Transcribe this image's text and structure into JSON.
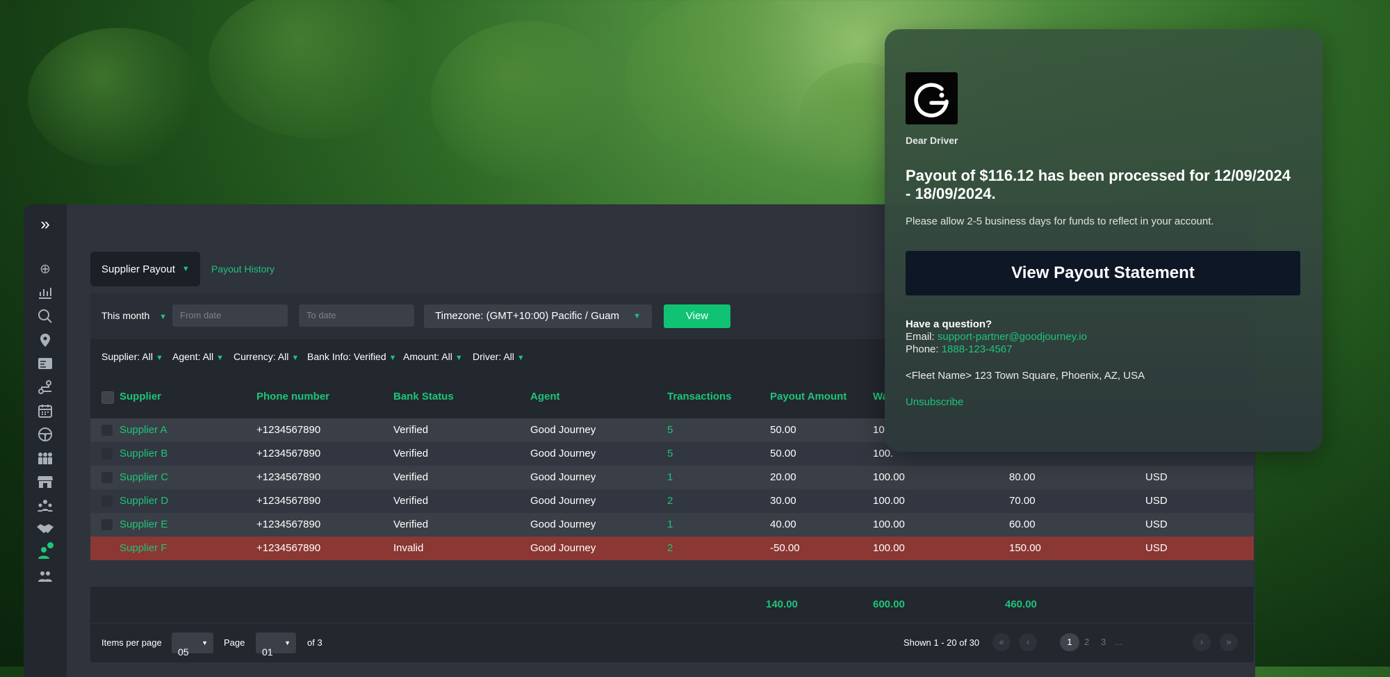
{
  "tabs": {
    "active": "Supplier Payout",
    "secondary": "Payout History"
  },
  "filters": {
    "period": "This month",
    "from_placeholder": "From date",
    "to_placeholder": "To date",
    "timezone": "Timezone: (GMT+10:00) Pacific / Guam",
    "view_label": "View"
  },
  "chips": [
    "Supplier: All",
    "Agent: All",
    "Currency: All",
    "Bank Info: Verified",
    "Amount: All",
    "Driver: All"
  ],
  "table": {
    "headers": [
      "Supplier",
      "Phone number",
      "Bank Status",
      "Agent",
      "Transactions",
      "Payout Amount",
      "Wa"
    ],
    "rows": [
      [
        "Supplier A",
        "+1234567890",
        "Verified",
        "Good Journey",
        "5",
        "50.00",
        "10",
        "",
        ""
      ],
      [
        "Supplier B",
        "+1234567890",
        "Verified",
        "Good Journey",
        "5",
        "50.00",
        "100.",
        "",
        ""
      ],
      [
        "Supplier C",
        "+1234567890",
        "Verified",
        "Good Journey",
        "1",
        "20.00",
        "100.00",
        "80.00",
        "USD"
      ],
      [
        "Supplier D",
        "+1234567890",
        "Verified",
        "Good Journey",
        "2",
        "30.00",
        "100.00",
        "70.00",
        "USD"
      ],
      [
        "Supplier E",
        "+1234567890",
        "Verified",
        "Good Journey",
        "1",
        "40.00",
        "100.00",
        "60.00",
        "USD"
      ],
      [
        "Supplier F",
        "+1234567890",
        "Invalid",
        "Good Journey",
        "2",
        "-50.00",
        "100.00",
        "150.00",
        "USD"
      ]
    ],
    "totals": [
      "140.00",
      "600.00",
      "460.00"
    ]
  },
  "pagination": {
    "items_per_page_label": "Items per page",
    "items_per_page": "05",
    "page_label": "Page",
    "page": "01",
    "of": "of 3",
    "shown": "Shown 1 - 20 of 30",
    "pages": [
      "1",
      "2",
      "3",
      "..."
    ]
  },
  "card": {
    "greeting": "Dear Driver",
    "title": "Payout of $116.12 has been processed for 12/09/2024 - 18/09/2024.",
    "subtitle": "Please allow 2-5 business days for funds to reflect in your account.",
    "button": "View Payout Statement",
    "question": "Have a question?",
    "email_label": "Email:",
    "email": "support-partner@goodjourney.io",
    "phone_label": "Phone:",
    "phone": "1888-123-4567",
    "address": "<Fleet Name> 123 Town Square, Phoenix, AZ, USA",
    "unsubscribe": "Unsubscribe"
  },
  "colors": {
    "accent": "#1ec47a",
    "invalid_row": "#8b3733",
    "button_dark": "#0e1726"
  },
  "icons": [
    "expand-icon",
    "add-circle-icon",
    "analytics-icon",
    "search-analytics-icon",
    "location-icon",
    "checklist-icon",
    "route-icon",
    "calendar-icon",
    "steering-wheel-icon",
    "group-icon",
    "store-icon",
    "team-icon",
    "handshake-icon",
    "user-badge-icon",
    "users-icon"
  ]
}
